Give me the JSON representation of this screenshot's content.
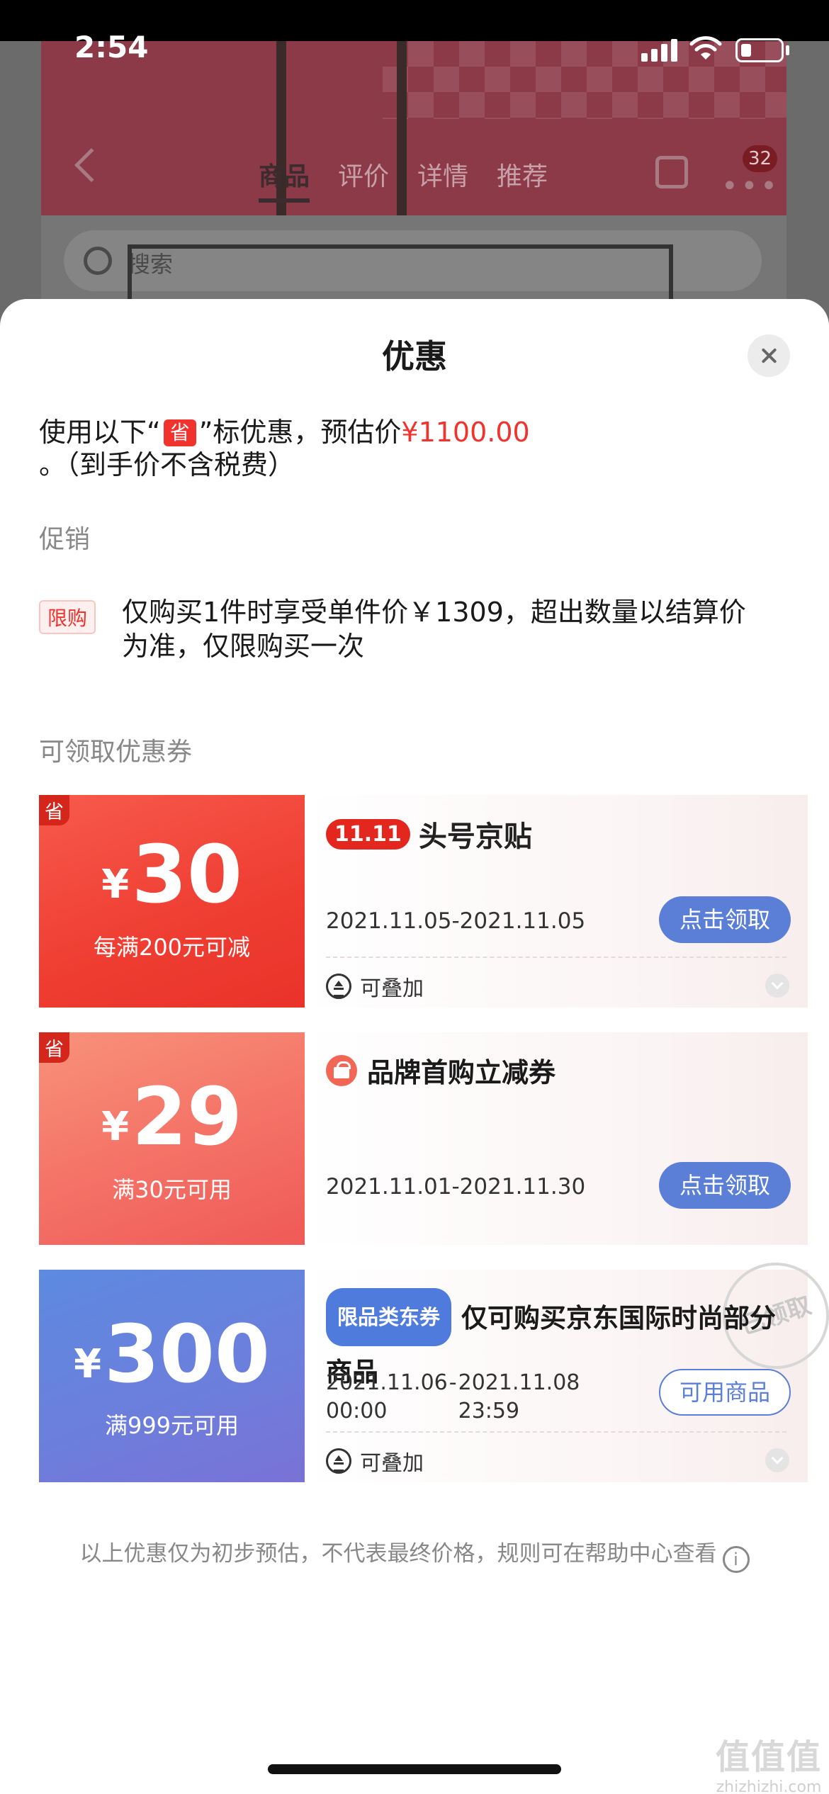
{
  "status_bar": {
    "time": "2:54"
  },
  "background_page": {
    "tabs": [
      "商品",
      "评价",
      "详情",
      "推荐"
    ],
    "search_placeholder": "搜索",
    "badge_count": "32"
  },
  "sheet": {
    "title": "优惠",
    "estimate": {
      "prefix": "使用以下“",
      "tag": "省",
      "middle": "”标优惠，预估价",
      "price": "¥1100.00",
      "suffix": " 。（到手价不含税费）"
    },
    "promo_section_label": "促销",
    "promo": {
      "tag": "限购",
      "text": "仅购买1件时享受单件价￥1309，超出数量以结算价为准，仅限购买一次"
    },
    "coupon_section_label": "可领取优惠券",
    "coupons": [
      {
        "corner_tag": "省",
        "currency": "¥",
        "amount": "30",
        "condition": "每满200元可减",
        "logo_badge": "11.11",
        "title": "头号京贴",
        "date": "2021.11.05-2021.11.05",
        "button": "点击领取",
        "stack_label": "可叠加"
      },
      {
        "corner_tag": "省",
        "currency": "¥",
        "amount": "29",
        "condition": "满30元可用",
        "title": "品牌首购立减券",
        "date": "2021.11.01-2021.11.30",
        "button": "点击领取"
      },
      {
        "currency": "¥",
        "amount": "300",
        "condition": "满999元可用",
        "category_tag": "限品类东券",
        "title": "仅可购买京东国际时尚部分商品",
        "date_start": "2021.11.06",
        "time_start": "00:00",
        "date_sep": "-",
        "date_end": "2021.11.08",
        "time_end": "23:59",
        "button": "可用商品",
        "stamp": "已领取",
        "stack_label": "可叠加"
      }
    ],
    "footer_note": "以上优惠仅为初步预估，不代表最终价格，规则可在帮助中心查看"
  },
  "watermark": {
    "glyph": "值值值",
    "domain": "zhizhizhi.com"
  },
  "colors": {
    "accent_red": "#f2322d",
    "button_blue": "#5b7fd6",
    "coupon_blue": "#6b7fdc"
  }
}
